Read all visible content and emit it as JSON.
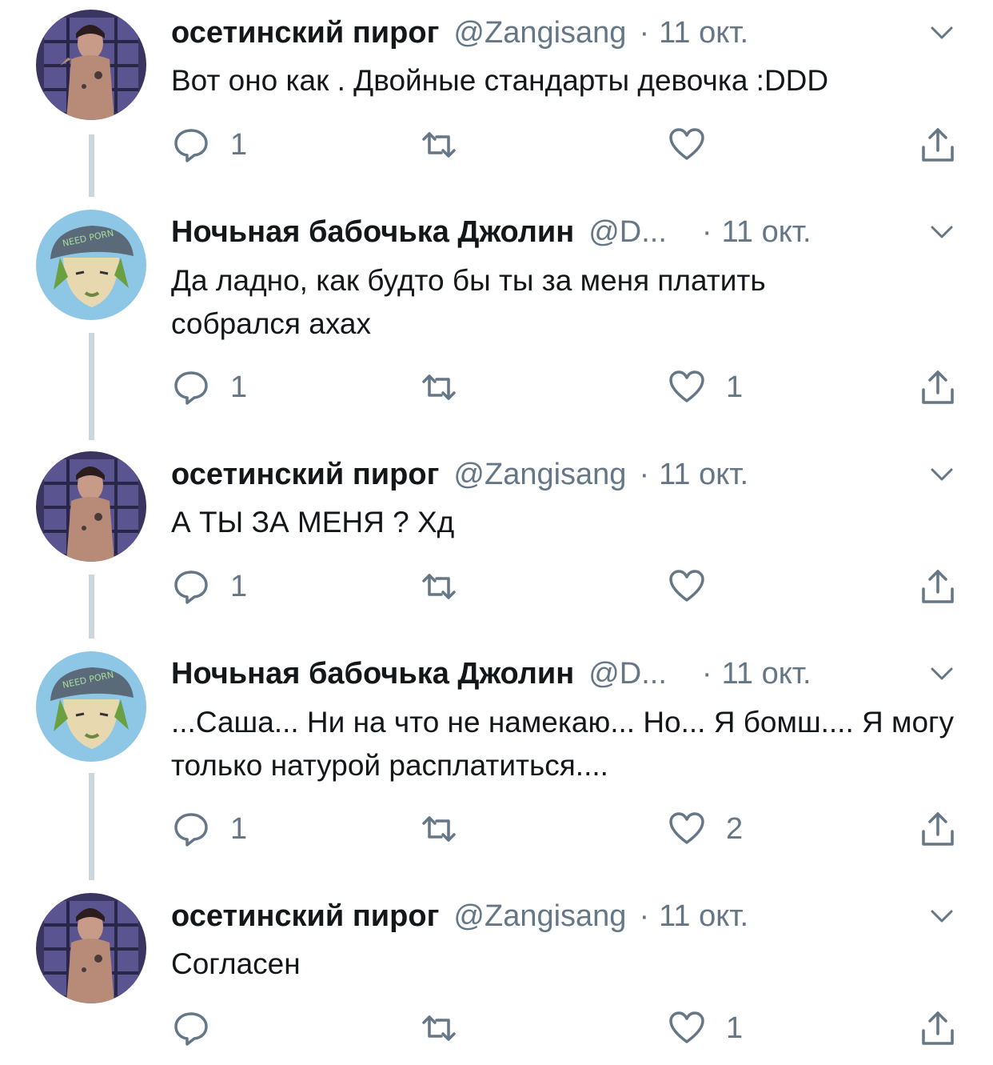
{
  "icon_color": "#657786",
  "line_color": "#ccd6dd",
  "tweets": [
    {
      "author": "осетинский пирог",
      "handle": "@Zangisang",
      "separator": "·",
      "date": "11 окт.",
      "avatar": "avatar-man-tattoo",
      "text": "Вот оно как . Двойные стандарты девочка :DDD",
      "replies": "1",
      "retweets": "",
      "likes": ""
    },
    {
      "author": "Ночьная бабочька Джолин",
      "handle": "@D...",
      "separator": "·",
      "date": "11 окт.",
      "avatar": "avatar-anime-cap",
      "text": "Да ладно, как будто бы ты за меня платить собрался ахах",
      "replies": "1",
      "retweets": "",
      "likes": "1"
    },
    {
      "author": "осетинский пирог",
      "handle": "@Zangisang",
      "separator": "·",
      "date": "11 окт.",
      "avatar": "avatar-man-tattoo",
      "text": "А ТЫ ЗА МЕНЯ ? Хд",
      "replies": "1",
      "retweets": "",
      "likes": ""
    },
    {
      "author": "Ночьная бабочька Джолин",
      "handle": "@D...",
      "separator": "·",
      "date": "11 окт.",
      "avatar": "avatar-anime-cap",
      "text": "...Саша... Ни на что не намекаю... Но... Я бомш.... Я могу только натурой расплатиться....",
      "replies": "1",
      "retweets": "",
      "likes": "2"
    },
    {
      "author": "осетинский пирог",
      "handle": "@Zangisang",
      "separator": "·",
      "date": "11 окт.",
      "avatar": "avatar-man-tattoo",
      "text": "Согласен",
      "replies": "",
      "retweets": "",
      "likes": "1"
    }
  ],
  "cap_text": "NEED PORN"
}
